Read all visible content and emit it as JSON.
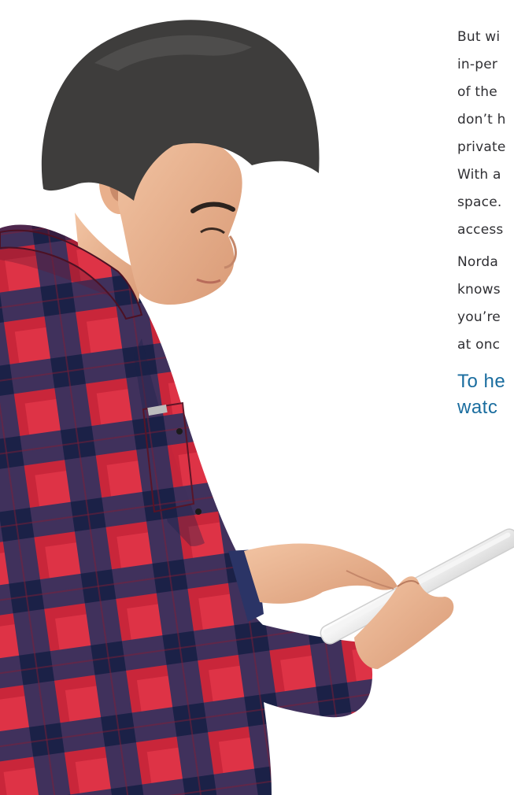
{
  "paragraphs": [
    {
      "lines": [
        "But wi",
        "in-per",
        "of the",
        "don’t h",
        "private",
        "With a",
        "space.",
        "access"
      ]
    },
    {
      "lines": [
        "Norda",
        "knows",
        "you’re",
        "at onc"
      ]
    }
  ],
  "heading": {
    "lines": [
      "To he",
      "watc"
    ]
  },
  "colors": {
    "body_text": "#2f2f33",
    "heading": "#1a6d9f",
    "shirt_red": "#c9263a",
    "shirt_navy": "#27305a"
  },
  "photo": {
    "subject": "boy in red and navy plaid shirt using a white tablet"
  }
}
